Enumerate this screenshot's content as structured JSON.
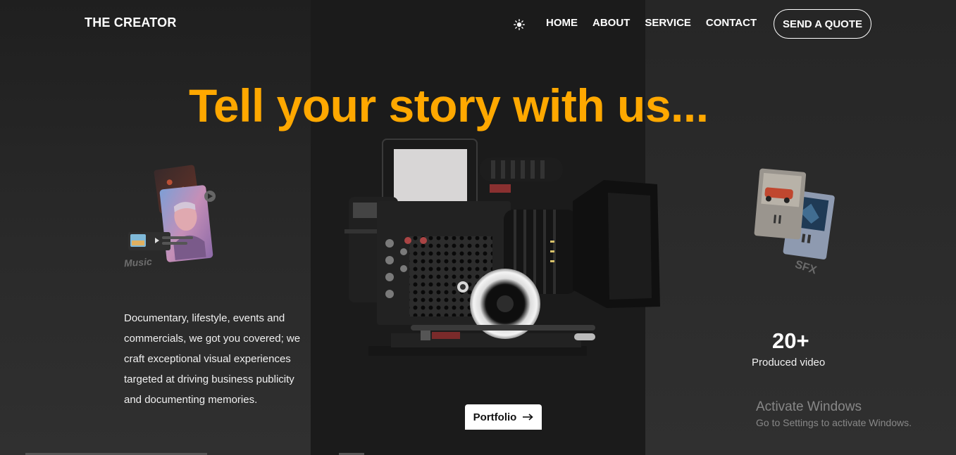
{
  "brand": "THE CREATOR",
  "nav": {
    "theme_icon": "sun-icon",
    "items": [
      "HOME",
      "ABOUT",
      "SERVICE",
      "CONTACT"
    ],
    "cta": "SEND A QUOTE"
  },
  "hero": {
    "headline": "Tell your story with us...",
    "accent_color": "#ffa800",
    "music_label": "Music",
    "sfx_label": "SFX",
    "description": "Documentary, lifestyle, events and commercials, we got you covered; we craft exceptional visual experiences targeted at driving business publicity and documenting memories.",
    "stat_value": "20+",
    "stat_label": "Produced video",
    "portfolio_label": "Portfolio",
    "portfolio_icon": "arrow-right-icon",
    "camera_icon": "cinema-camera-image"
  },
  "watermark": {
    "title": "Activate Windows",
    "subtitle": "Go to Settings to activate Windows."
  }
}
